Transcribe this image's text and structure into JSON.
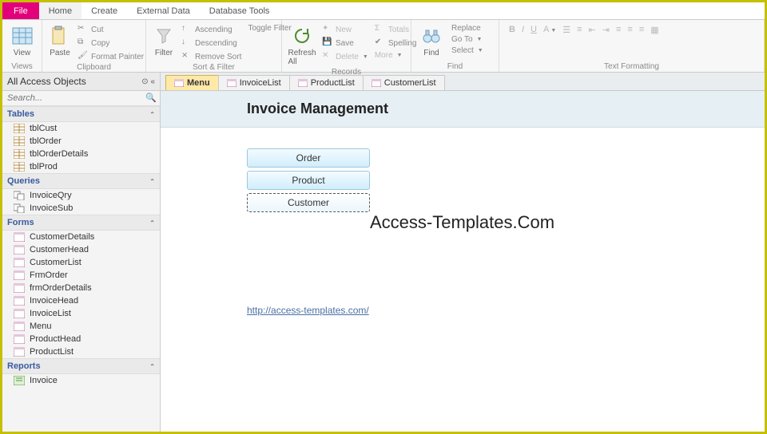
{
  "menubar": {
    "file": "File",
    "items": [
      "Home",
      "Create",
      "External Data",
      "Database Tools"
    ]
  },
  "ribbon": {
    "views": {
      "label": "Views",
      "view": "View"
    },
    "clipboard": {
      "label": "Clipboard",
      "paste": "Paste",
      "cut": "Cut",
      "copy": "Copy",
      "format_painter": "Format Painter"
    },
    "sort_filter": {
      "label": "Sort & Filter",
      "filter": "Filter",
      "ascending": "Ascending",
      "descending": "Descending",
      "remove_sort": "Remove Sort",
      "toggle_filter": "Toggle Filter"
    },
    "records": {
      "label": "Records",
      "refresh": "Refresh\nAll",
      "new": "New",
      "save": "Save",
      "delete": "Delete",
      "totals": "Totals",
      "spelling": "Spelling",
      "more": "More"
    },
    "find": {
      "label": "Find",
      "find": "Find",
      "replace": "Replace",
      "goto": "Go To",
      "select": "Select"
    },
    "text_formatting": {
      "label": "Text Formatting"
    }
  },
  "nav": {
    "title": "All Access Objects",
    "search_placeholder": "Search...",
    "sections": [
      {
        "name": "Tables",
        "items": [
          "tblCust",
          "tblOrder",
          "tblOrderDetails",
          "tblProd"
        ]
      },
      {
        "name": "Queries",
        "items": [
          "InvoiceQry",
          "InvoiceSub"
        ]
      },
      {
        "name": "Forms",
        "items": [
          "CustomerDetails",
          "CustomerHead",
          "CustomerList",
          "FrmOrder",
          "frmOrderDetails",
          "InvoiceHead",
          "InvoiceList",
          "Menu",
          "ProductHead",
          "ProductList"
        ]
      },
      {
        "name": "Reports",
        "items": [
          "Invoice"
        ]
      }
    ]
  },
  "tabs": [
    "Menu",
    "InvoiceList",
    "ProductList",
    "CustomerList"
  ],
  "form": {
    "title": "Invoice Management",
    "buttons": [
      "Order",
      "Product",
      "Customer"
    ],
    "watermark": "Access-Templates.Com",
    "link": "http://access-templates.com/"
  }
}
